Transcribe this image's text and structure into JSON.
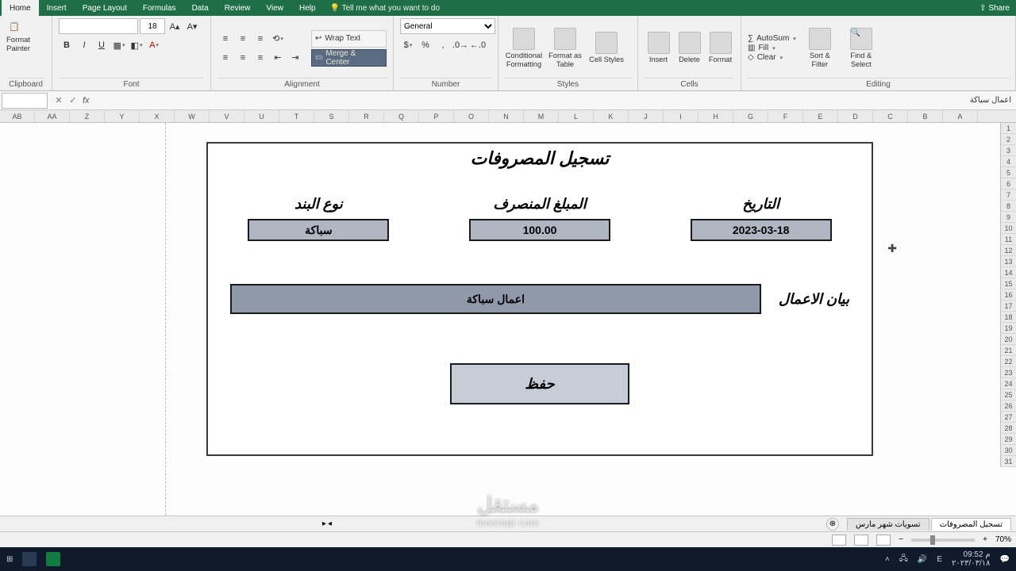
{
  "ribbon_tabs": {
    "home": "Home",
    "insert": "Insert",
    "page_layout": "Page Layout",
    "formulas": "Formulas",
    "data": "Data",
    "review": "Review",
    "view": "View",
    "help": "Help",
    "tell_me": "Tell me what you want to do",
    "share": "Share"
  },
  "clipboard": {
    "format_painter": "Format Painter",
    "label": "Clipboard"
  },
  "font": {
    "name": "",
    "size": "18",
    "bold": "B",
    "italic": "I",
    "underline": "U",
    "label": "Font"
  },
  "alignment": {
    "wrap": "Wrap Text",
    "merge": "Merge & Center",
    "label": "Alignment"
  },
  "number": {
    "format": "General",
    "label": "Number"
  },
  "styles": {
    "cond": "Conditional Formatting",
    "table": "Format as Table",
    "cell": "Cell Styles",
    "label": "Styles"
  },
  "cells": {
    "insert": "Insert",
    "delete": "Delete",
    "format": "Format",
    "label": "Cells"
  },
  "editing": {
    "autosum": "AutoSum",
    "fill": "Fill",
    "clear": "Clear",
    "sort": "Sort & Filter",
    "find": "Find & Select",
    "label": "Editing"
  },
  "namebox": {
    "ar": "اعمال سباكة"
  },
  "columns": [
    "AB",
    "AA",
    "Z",
    "Y",
    "X",
    "W",
    "V",
    "U",
    "T",
    "S",
    "R",
    "Q",
    "P",
    "O",
    "N",
    "M",
    "L",
    "K",
    "J",
    "I",
    "H",
    "G",
    "F",
    "E",
    "D",
    "C",
    "B",
    "A"
  ],
  "rows": [
    "1",
    "2",
    "3",
    "4",
    "5",
    "6",
    "7",
    "8",
    "9",
    "10",
    "11",
    "12",
    "13",
    "14",
    "15",
    "16",
    "17",
    "18",
    "19",
    "20",
    "21",
    "22",
    "23",
    "24",
    "25",
    "26",
    "27",
    "28",
    "29",
    "30",
    "31"
  ],
  "form": {
    "title": "تسجيل المصروفات",
    "date_label": "التاريخ",
    "date_value": "2023-03-18",
    "amount_label": "المبلغ المنصرف",
    "amount_value": "100.00",
    "type_label": "نوع البند",
    "type_value": "سباكة",
    "desc_label": "بيان الاعمال",
    "desc_value": "اعمال سباكة",
    "save": "حفظ"
  },
  "sheets": {
    "active": "تسجيل المصروفات",
    "other": "تسويات شهر مارس"
  },
  "zoom": "70%",
  "watermark": {
    "brand": "مستقل",
    "site": "mostaql.com"
  },
  "taskbar": {
    "time": "09:52 م",
    "date": "٢٠٢٣/٠٣/١٨",
    "lang": "E"
  }
}
